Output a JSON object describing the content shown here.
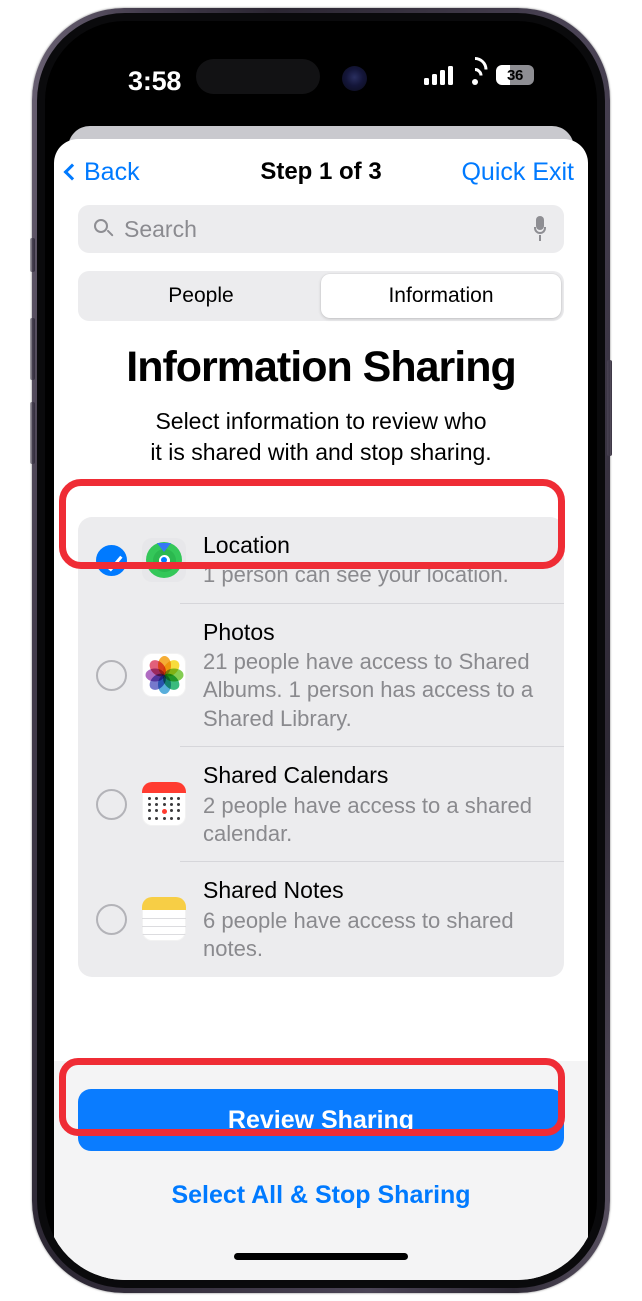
{
  "status_bar": {
    "time": "3:58",
    "lock_icon": "portrait-orientation-lock-icon",
    "signal_icon": "cellular-signal-icon",
    "signal_bars": 4,
    "wifi_icon": "wifi-icon",
    "battery_percent": "36",
    "battery_level": 36
  },
  "nav": {
    "back_label": "Back",
    "title": "Step 1 of 3",
    "action_label": "Quick Exit"
  },
  "search": {
    "placeholder": "Search",
    "value": "",
    "search_icon": "magnifier-icon",
    "mic_icon": "microphone-icon"
  },
  "segmented": {
    "options": [
      "People",
      "Information"
    ],
    "selected": "Information"
  },
  "main": {
    "headline": "Information Sharing",
    "subtitle_line1": "Select information to review who",
    "subtitle_line2": "it is shared with and stop sharing."
  },
  "list": [
    {
      "title": "Location",
      "subtitle": "1 person can see your location.",
      "icon": "find-my-icon",
      "selected": true,
      "highlighted": true
    },
    {
      "title": "Photos",
      "subtitle": "21 people have access to Shared Albums. 1 person has access to a Shared Library.",
      "icon": "photos-icon",
      "selected": false,
      "highlighted": false
    },
    {
      "title": "Shared Calendars",
      "subtitle": "2 people have access to a shared calendar.",
      "icon": "calendar-icon",
      "selected": false,
      "highlighted": false
    },
    {
      "title": "Shared Notes",
      "subtitle": "6 people have access to shared notes.",
      "icon": "notes-icon",
      "selected": false,
      "highlighted": false
    }
  ],
  "footer": {
    "primary_button": "Review Sharing",
    "secondary_link": "Select All & Stop Sharing"
  },
  "colors": {
    "accent_blue": "#007aff",
    "button_blue": "#0a7cff",
    "highlight_red": "#ef2c35",
    "list_bg": "#ececee",
    "secondary_text": "#8a8a8e"
  }
}
